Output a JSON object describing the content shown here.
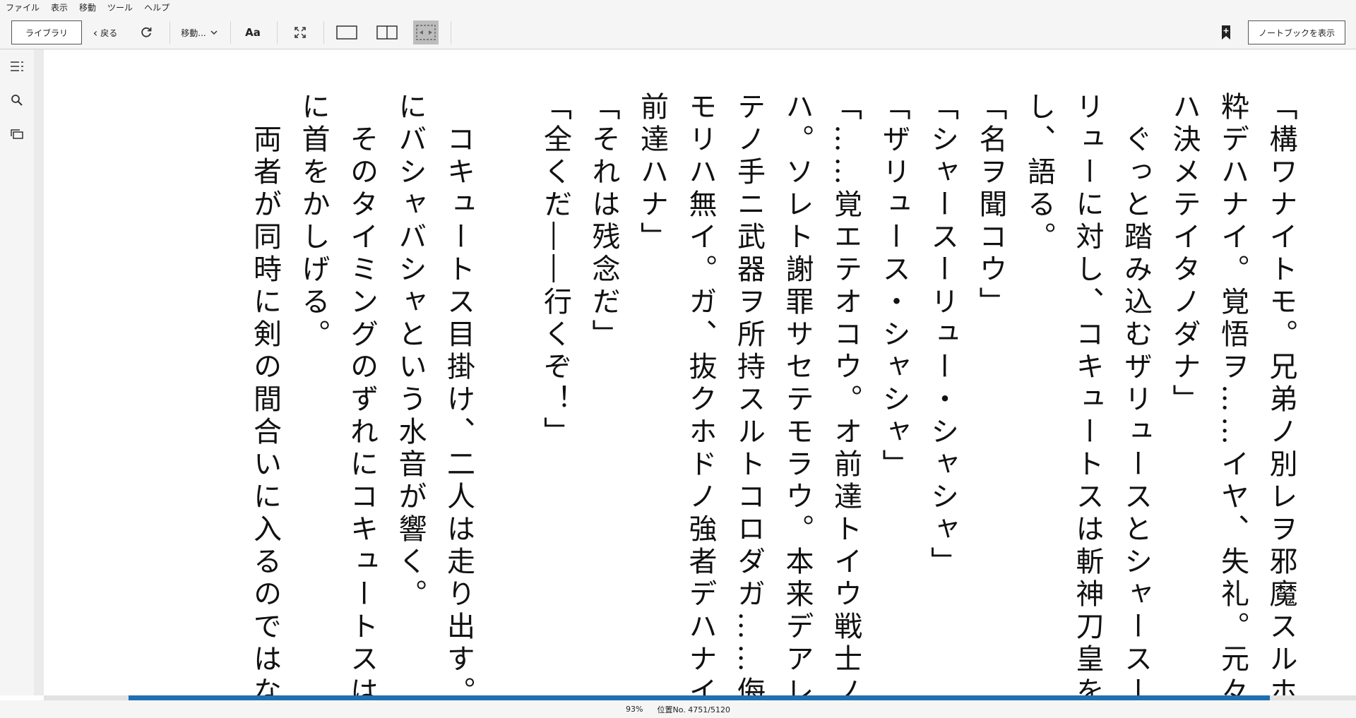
{
  "menu": [
    "ファイル",
    "表示",
    "移動",
    "ツール",
    "ヘルプ"
  ],
  "toolbar": {
    "library_label": "ライブラリ",
    "back_label": "戻る",
    "goto_label": "移動...",
    "font_label": "Aa",
    "notebook_label": "ノートブックを表示"
  },
  "icons": {
    "back": "chevron-left-icon",
    "refresh": "refresh-icon",
    "goto_arrow": "chevron-down-icon",
    "fullscreen": "fullscreen-icon",
    "single_page": "single-page-icon",
    "two_page": "two-page-icon",
    "fit": "fit-page-icon",
    "bookmark": "bookmark-add-icon",
    "toc": "toc-icon",
    "search": "search-icon",
    "flashcards": "flashcards-icon"
  },
  "text_columns": [
    "「構ワナイトモ。兄弟ノ別レヲ邪魔スルホド無",
    "粋デハナイ。覚悟ヲ……イヤ、失礼。元々覚悟",
    "ハ決メテイタノダナ」",
    "　ぐっと踏み込むザリュースとシャースー",
    "リューに対し、コキュートスは斬神刀皇を一閃",
    "し、語る。",
    "「名ヲ聞コウ」",
    "「シャースーリュー・シャシャ」",
    "「ザリュース・シャシャ」",
    "「……覚エテオコウ。オ前達トイウ戦士ノコト",
    "ハ。ソレト謝罪サセテモラウ。本来デアレバ全",
    "テノ手ニ武器ヲ所持スルトコロダガ……侮ルツ",
    "モリハ無イ。ガ、抜クホドノ強者デハナイ。オ",
    "前達ハナ」",
    "「それは残念だ」",
    "「全くだ――行くぞ！」",
    "",
    "　コキュートス目掛け、二人は走り出す。湿地",
    "にバシャバシャという水音が響く。",
    "　そのタイミングのずれにコキュートスは僅か",
    "に首をかしげる。",
    "　両者が同時に剣の間合いに入るのではなく、"
  ],
  "status": {
    "percent": "93%",
    "location": "位置No. 4751/5120",
    "progress_fraction": 0.93
  }
}
